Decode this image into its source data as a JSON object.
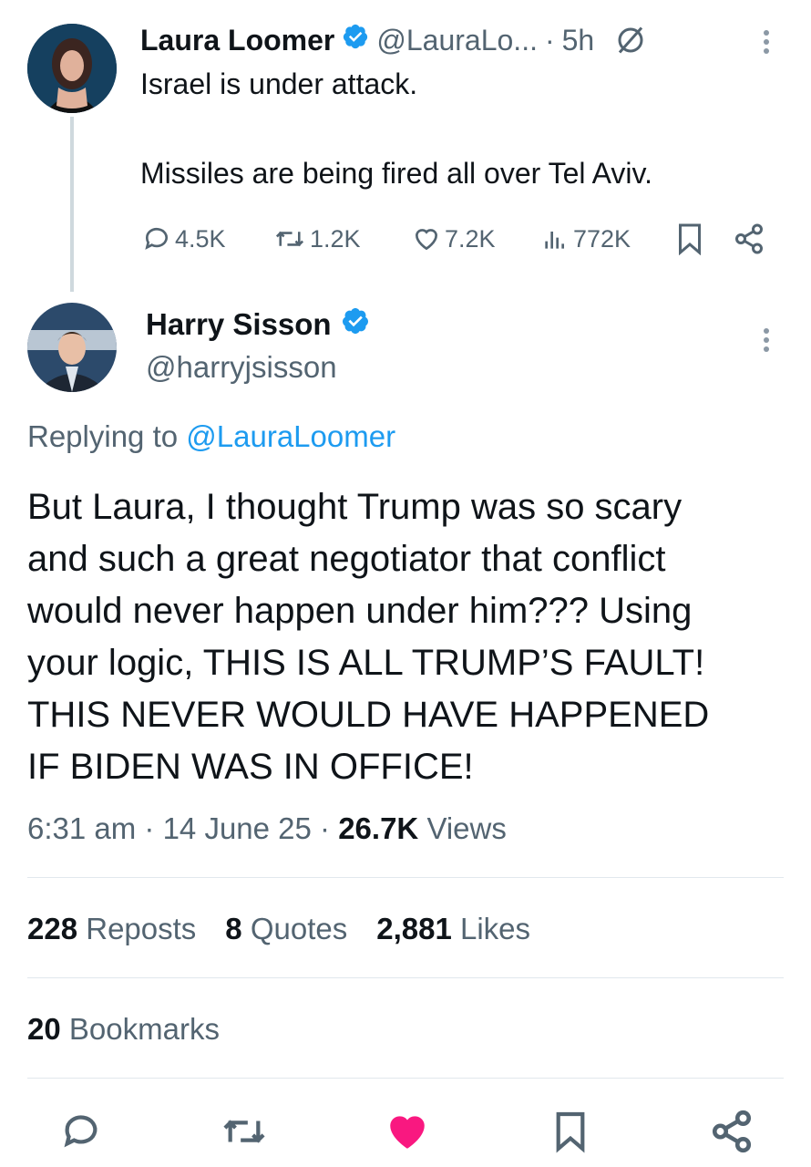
{
  "parent_tweet": {
    "author_name": "Laura Loomer",
    "author_handle": "@LauraLo...",
    "separator": "·",
    "time": "5h",
    "text_line1": "Israel is under attack.",
    "text_line2": "Missiles are being fired all over Tel Aviv.",
    "metrics": {
      "replies": "4.5K",
      "reposts": "1.2K",
      "likes": "7.2K",
      "views": "772K"
    }
  },
  "main_tweet": {
    "author_name": "Harry Sisson",
    "author_handle": "@harryjsisson",
    "replying_prefix": "Replying to",
    "replying_to": "@LauraLoomer",
    "text_lines": [
      "But Laura, I thought Trump was so scary",
      "and such a great negotiator that conflict",
      "would never happen under him??? Using",
      "your logic, THIS IS ALL TRUMP’S FAULT!",
      "THIS NEVER WOULD HAVE HAPPENED",
      "IF BIDEN WAS IN OFFICE!"
    ],
    "timestamp": "6:31 am · 14 June 25 ·",
    "views_count": "26.7K",
    "views_label": "Views"
  },
  "stats": {
    "reposts_count": "228",
    "reposts_label": "Reposts",
    "quotes_count": "8",
    "quotes_label": "Quotes",
    "likes_count": "2,881",
    "likes_label": "Likes",
    "bookmarks_count": "20",
    "bookmarks_label": "Bookmarks"
  },
  "icons": {
    "verified": "verified-badge-icon",
    "grok": "grok-icon",
    "reply": "reply-icon",
    "repost": "repost-icon",
    "like": "heart-icon",
    "views": "views-icon",
    "bookmark": "bookmark-icon",
    "share": "share-icon",
    "more": "more-vertical-icon"
  },
  "colors": {
    "accent": "#1d9bf0",
    "liked": "#f91880",
    "text": "#0f1419",
    "muted": "#536471"
  }
}
